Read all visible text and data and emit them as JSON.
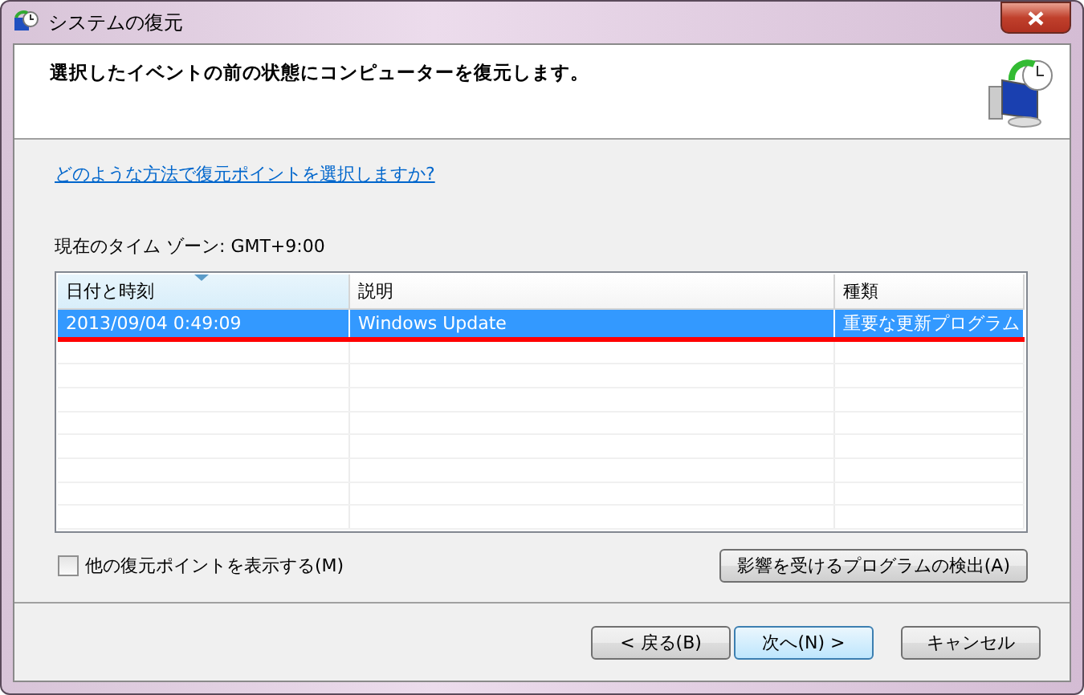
{
  "window": {
    "title": "システムの復元"
  },
  "header": {
    "title": "選択したイベントの前の状態にコンピューターを復元します。"
  },
  "help_link": "どのような方法で復元ポイントを選択しますか?",
  "timezone": "現在のタイム ゾーン: GMT+9:00",
  "table": {
    "columns": [
      {
        "label": "日付と時刻",
        "sorted": true
      },
      {
        "label": "説明",
        "sorted": false
      },
      {
        "label": "種類",
        "sorted": false
      }
    ],
    "rows": [
      {
        "cells": [
          "2013/09/04 0:49:09",
          "Windows Update",
          "重要な更新プログラム"
        ],
        "selected": true,
        "underlined": true
      }
    ]
  },
  "show_more": {
    "label": "他の復元ポイントを表示する(M)",
    "checked": false
  },
  "scan_button": "影響を受けるプログラムの検出(A)",
  "buttons": [
    {
      "label": "< 戻る(B)",
      "default": false
    },
    {
      "label": "次へ(N) >",
      "default": true
    },
    {
      "label": "キャンセル",
      "default": false
    }
  ]
}
